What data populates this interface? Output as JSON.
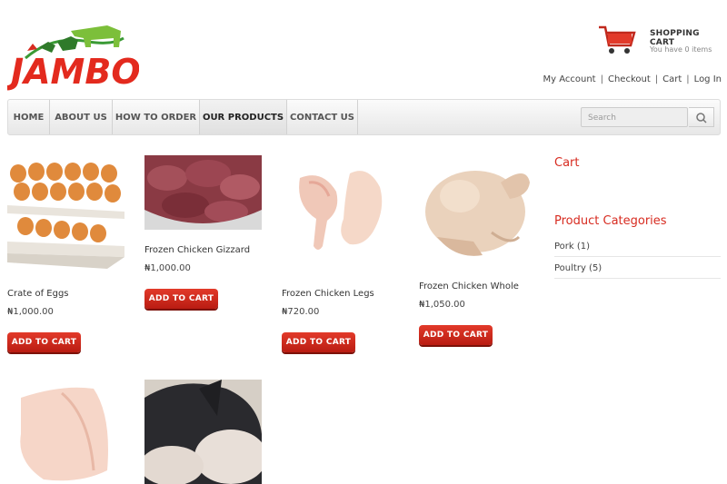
{
  "brand": {
    "logo_text": "JAMBO"
  },
  "cart_widget": {
    "title": "SHOPPING CART",
    "subtitle": "You have 0 items"
  },
  "top_links": [
    "My Account",
    "Checkout",
    "Cart",
    "Log In"
  ],
  "nav": {
    "items": [
      "HOME",
      "ABOUT US",
      "HOW TO ORDER",
      "OUR PRODUCTS",
      "CONTACT US"
    ],
    "active": "OUR PRODUCTS",
    "search_placeholder": "Search"
  },
  "products": [
    {
      "name": "Crate of Eggs",
      "price": "₦1,000.00",
      "button": "ADD TO CART"
    },
    {
      "name": "Frozen Chicken Gizzard",
      "price": "₦1,000.00",
      "button": "ADD TO CART"
    },
    {
      "name": "Frozen Chicken Legs",
      "price": "₦720.00",
      "button": "ADD TO CART"
    },
    {
      "name": "Frozen Chicken Whole",
      "price": "₦1,050.00",
      "button": "ADD TO CART"
    }
  ],
  "sidebar": {
    "cart_title": "Cart",
    "categories_title": "Product Categories",
    "categories": [
      "Pork (1)",
      "Poultry (5)"
    ]
  },
  "colors": {
    "accent": "#d72b20",
    "button": "#c9261a"
  }
}
